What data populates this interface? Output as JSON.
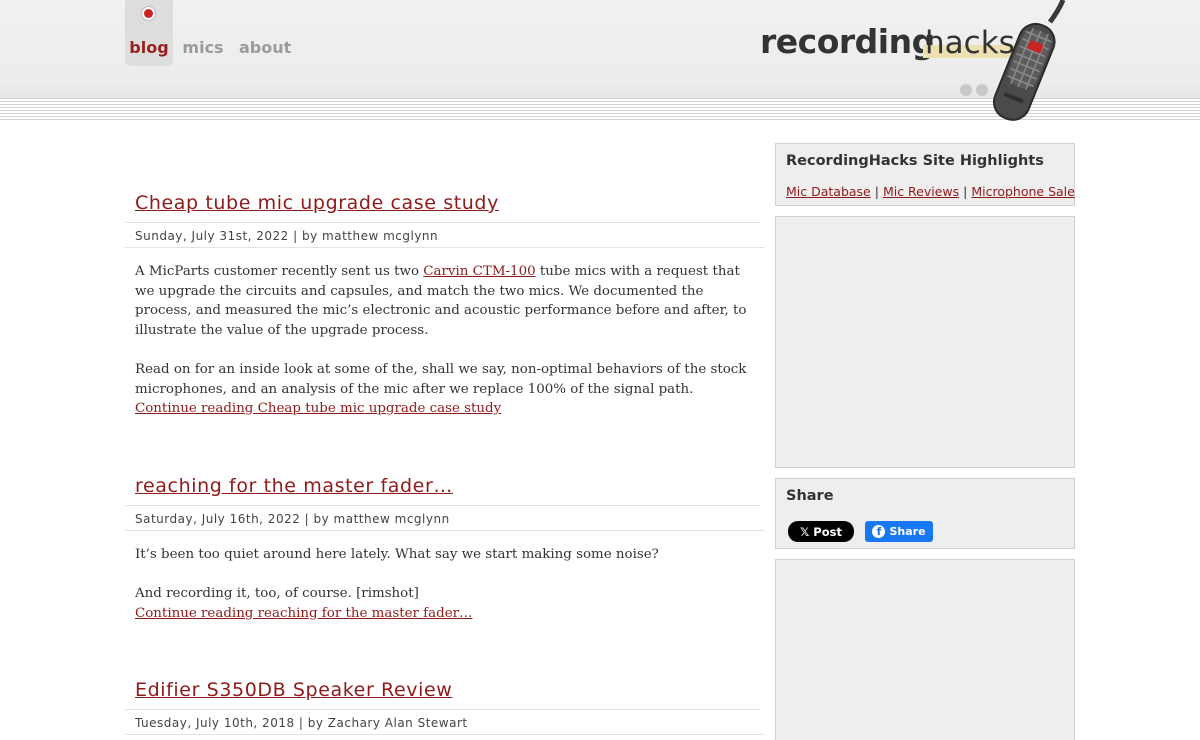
{
  "nav": {
    "tabs": [
      {
        "label": "blog",
        "active": true
      },
      {
        "label": "mics",
        "active": false
      },
      {
        "label": "about",
        "active": false
      }
    ]
  },
  "logo": {
    "part1": "recording",
    "part2": "hacks",
    "icon": "microphone-icon"
  },
  "posts": [
    {
      "title": "Cheap tube mic upgrade case study",
      "meta": "Sunday, July 31st, 2022 | by matthew mcglynn",
      "p1_before_link": "A MicParts customer recently sent us two ",
      "p1_link": "Carvin CTM-100",
      "p1_after_link": " tube mics with a request that we upgrade the circuits and capsules, and match the two mics. We documented the process, and measured the mic’s electronic and acoustic performance before and after, to illustrate the value of the upgrade process.",
      "p2": "Read on for an inside look at some of the, shall we say, non-optimal behaviors of the stock microphones, and an analysis of the mic after we replace 100% of the signal path.",
      "continue": "Continue reading Cheap tube mic upgrade case study"
    },
    {
      "title": "reaching for the master fader…",
      "meta": "Saturday, July 16th, 2022 | by matthew mcglynn",
      "p1": "It’s been too quiet around here lately. What say we start making some noise?",
      "p2": "And recording it, too, of course. [rimshot]",
      "continue": "Continue reading reaching for the master fader…"
    },
    {
      "title": "Edifier S350DB Speaker Review",
      "meta": "Tuesday, July 10th, 2018 | by Zachary Alan Stewart"
    }
  ],
  "sidebar": {
    "highlights": {
      "title": "RecordingHacks Site Highlights",
      "links": [
        "Mic Database",
        "Mic Reviews",
        "Microphone Sale"
      ],
      "separator": "|"
    },
    "share": {
      "title": "Share",
      "x_label": "Post",
      "x_icon": "x-logo-icon",
      "fb_label": "Share",
      "fb_icon": "facebook-icon"
    }
  },
  "colors": {
    "accent": "#8e1a1a",
    "text": "#333333",
    "sidebar_bg": "#eeeeee",
    "fb_blue": "#1877f2",
    "logo_highlight": "#ecdfb0"
  }
}
